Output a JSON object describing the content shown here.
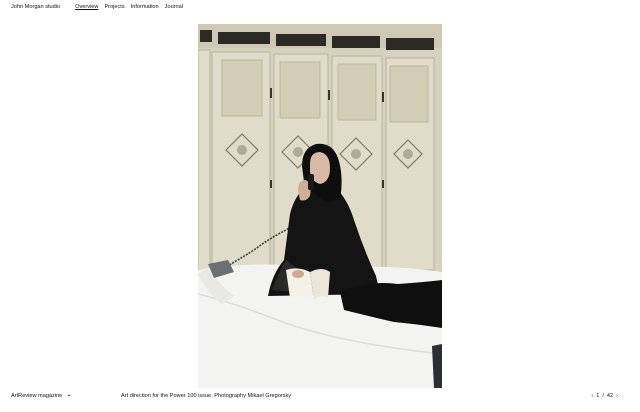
{
  "header": {
    "brand": "John Morgan studio",
    "nav": [
      {
        "label": "Overview",
        "active": true
      },
      {
        "label": "Projects",
        "active": false
      },
      {
        "label": "Information",
        "active": false
      },
      {
        "label": "Journal",
        "active": false
      }
    ]
  },
  "footer": {
    "project": "ArtReview magazine",
    "project_toggle": "+",
    "caption": "Art direction for the Power 100 issue. Photography Mikael Gregorsky",
    "pager": {
      "prev": "‹",
      "current": "1",
      "sep": "/",
      "total": "42",
      "next": "›"
    }
  },
  "photo": {
    "icon": "photo-woman-on-phone",
    "colors": {
      "wall": "#d6d0bc",
      "door": "#e0dbc7",
      "bed": "#f4f4f2",
      "dress": "#141414"
    }
  }
}
